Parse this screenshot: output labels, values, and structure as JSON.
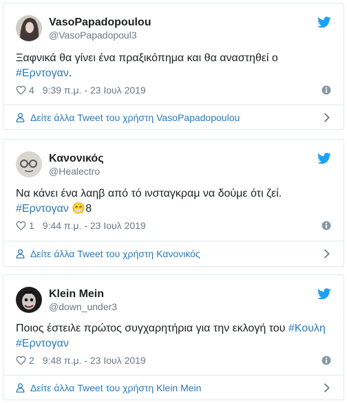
{
  "colors": {
    "link": "#2b7bb9",
    "muted": "#697882",
    "border": "#e1e8ed",
    "bird": "#1da1f2"
  },
  "icons": {
    "brand": "twitter-bird-icon",
    "like": "heart-icon",
    "info": "info-icon",
    "profile": "person-icon",
    "chevron": "chevron-right-icon"
  },
  "tweets": [
    {
      "name": "VasoPapadopoulou",
      "handle": "@VasoPapadopoul3",
      "text_before": "Ξαφνικά θα γίνει ένα πραξικόπημα και θα αναστηθεί ο ",
      "hashtag": "#Ερντογαν",
      "text_after": ".",
      "likes": "4",
      "time": "9:39 π.μ. - 23 Ιουλ 2019",
      "more": "Δείτε άλλα Tweet του χρήστη VasoPapadopoulou"
    },
    {
      "name": "Κανονικός",
      "handle": "@Healectro",
      "text_before": "Να κάνει ένα λαηβ από τό ινσταγκραμ να δούμε ότι ζεί.",
      "hashtag": "#Ερντογαν",
      "emoji": "😁",
      "text_after": "8",
      "likes": "1",
      "time": "9:44 π.μ. - 23 Ιουλ 2019",
      "more": "Δείτε άλλα Tweet του χρήστη Κανονικός"
    },
    {
      "name": "Klein Mein",
      "handle": "@down_under3",
      "text_before": "Ποιος έστειλε πρώτος συγχαρητήρια για την εκλογή του ",
      "hashtag": "#Κουλη",
      "hashtag2": "#Ερντογαν",
      "likes": "2",
      "time": "9:48 π.μ. - 23 Ιουλ 2019",
      "more": "Δείτε άλλα Tweet του χρήστη Klein Mein"
    }
  ]
}
